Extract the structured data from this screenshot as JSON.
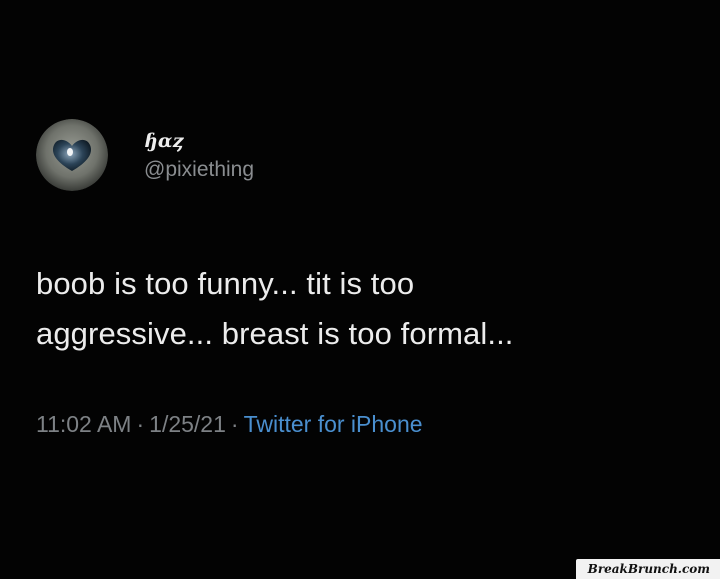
{
  "tweet": {
    "display_name": "ɧαȥ",
    "handle": "@pixiething",
    "text": "boob is too funny... tit is too\naggressive... breast is too formal...",
    "time": "11:02 AM",
    "separator": "·",
    "date": "1/25/21",
    "source": "Twitter for iPhone"
  },
  "watermark": "BreakBrunch.com",
  "colors": {
    "background": "#030303",
    "text": "#ececec",
    "muted": "#7d8185",
    "link": "#4a8fcf"
  },
  "icons": {
    "avatar": "profile-photo"
  }
}
